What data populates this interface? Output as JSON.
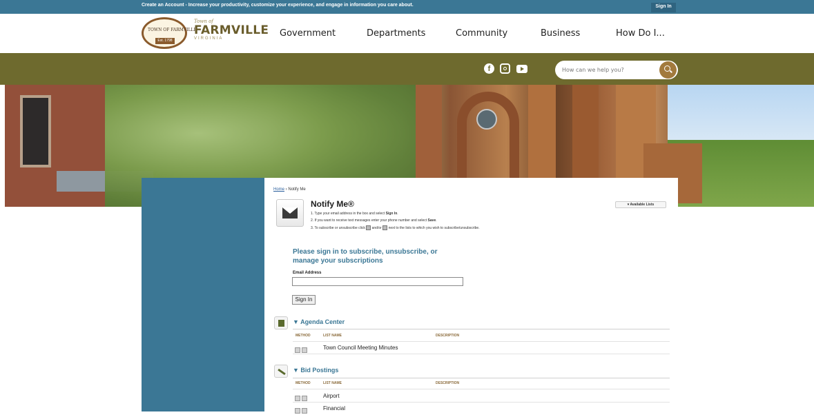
{
  "topbar": {
    "message": "Create an Account - Increase your productivity, customize your experience, and engage in information you care about.",
    "signin_label": "Sign In"
  },
  "header": {
    "seal_name": "TOWN OF FARMVILLE",
    "seal_est": "Est. 1798",
    "town_of": "Town of",
    "name": "FARMVILLE",
    "state": "VIRGINIA",
    "nav": [
      "Government",
      "Departments",
      "Community",
      "Business",
      "How Do I..."
    ]
  },
  "social": {
    "icons": [
      "facebook-icon",
      "instagram-icon",
      "youtube-icon"
    ]
  },
  "search": {
    "placeholder": "How can we help you?"
  },
  "breadcrumb": {
    "home": "Home",
    "separator": " › ",
    "current": "Notify Me"
  },
  "page": {
    "title": "Notify Me®",
    "steps": [
      {
        "before": "1. Type your email address in the box and select ",
        "bold": "Sign In",
        "after": "."
      },
      {
        "before": "2. If you want to receive text messages enter your phone number and select ",
        "bold": "Save",
        "after": "."
      },
      {
        "before": "3. To subscribe or unsubscribe click ",
        "mid": " and/or ",
        "after": " next to the lists to which you wish to subscribe/unsubscribe."
      }
    ],
    "available_lists": "Available Lists"
  },
  "signin": {
    "heading": "Please sign in to subscribe, unsubscribe, or manage your subscriptions",
    "email_label": "Email Address",
    "email_value": "",
    "button_label": "Sign In"
  },
  "sections": [
    {
      "title": "▼ Agenda Center",
      "columns": [
        "METHOD",
        "LIST NAME",
        "DESCRIPTION"
      ],
      "rows": [
        {
          "name": "Town Council Meeting Minutes"
        }
      ]
    },
    {
      "title": "▼ Bid Postings",
      "columns": [
        "METHOD",
        "LIST NAME",
        "DESCRIPTION"
      ],
      "rows": [
        {
          "name": "Airport"
        },
        {
          "name": "Financial"
        }
      ]
    }
  ],
  "colors": {
    "topbar": "#3b7795",
    "olive_bar": "#6e6a2e",
    "brand_text": "#6a5d2c",
    "accent_search": "#a27a3d",
    "section_title": "#3b7795",
    "sidebar": "#3b7795"
  }
}
